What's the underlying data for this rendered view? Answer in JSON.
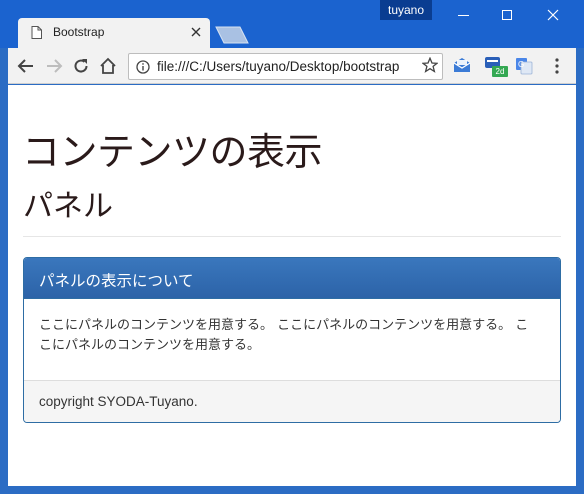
{
  "window": {
    "profile_name": "tuyano",
    "minimize_label": "",
    "maximize_label": "",
    "close_label": ""
  },
  "tab": {
    "title": "Bootstrap",
    "icon": "page-icon"
  },
  "toolbar": {
    "url": "file:///C:/Users/tuyano/Desktop/bootstrap",
    "extension_badge": "2d"
  },
  "page": {
    "title": "コンテンツの表示",
    "subtitle": "パネル",
    "panel": {
      "heading": "パネルの表示について",
      "body": "ここにパネルのコンテンツを用意する。 ここにパネルのコンテンツを用意する。 ここにパネルのコンテンツを用意する。",
      "footer": "copyright SYODA-Tuyano."
    }
  },
  "colors": {
    "titlebar": "#1b63cf",
    "panel_primary": "#2e6da4",
    "text": "#333333"
  }
}
